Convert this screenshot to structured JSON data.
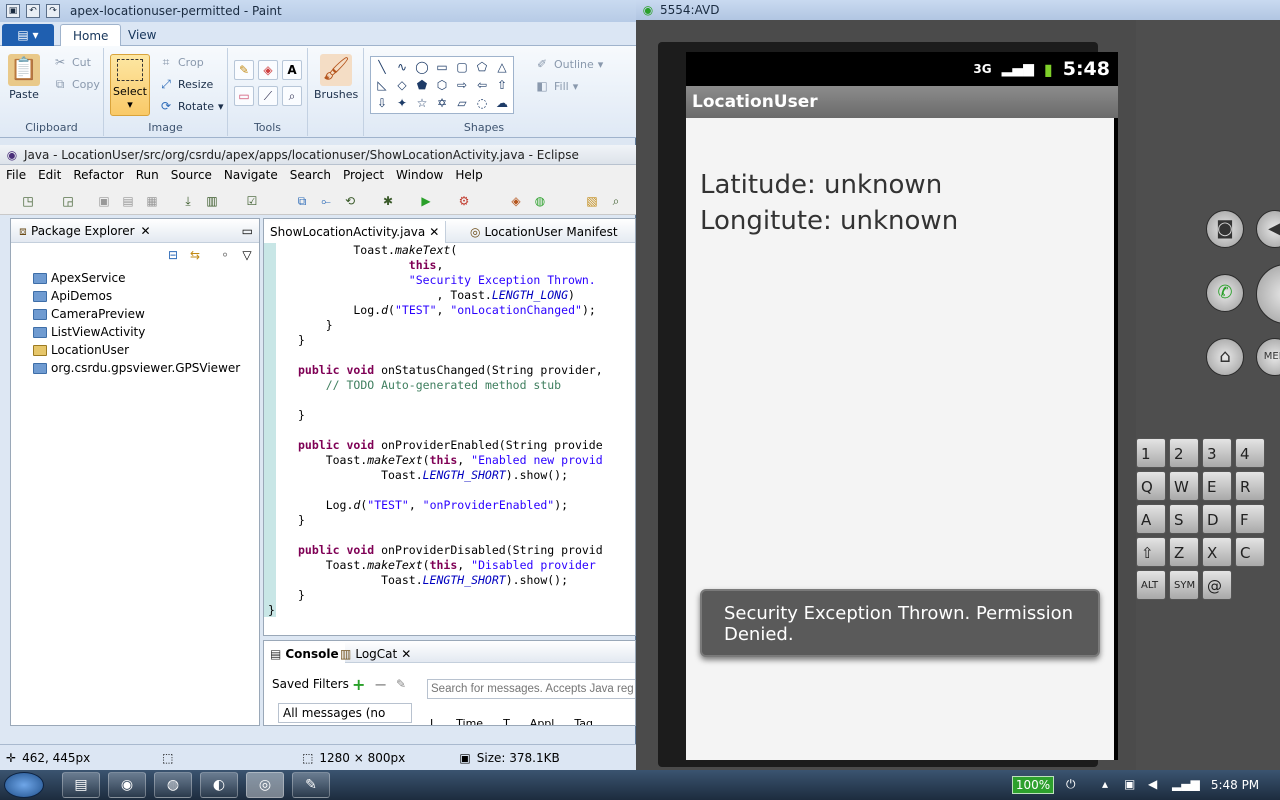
{
  "paint": {
    "title": "apex-locationuser-permitted - Paint",
    "tabs": {
      "home": "Home",
      "view": "View"
    },
    "clipboard": {
      "paste": "Paste",
      "cut": "Cut",
      "copy": "Copy",
      "label": "Clipboard"
    },
    "image": {
      "select": "Select",
      "crop": "Crop",
      "resize": "Resize",
      "rotate": "Rotate",
      "label": "Image"
    },
    "tools": {
      "label": "Tools"
    },
    "brushes": {
      "label": "Brushes"
    },
    "shapes": {
      "outline": "Outline",
      "fill": "Fill",
      "label": "Shapes"
    },
    "status": {
      "cursor": "462, 445px",
      "dimensions": "1280 × 800px",
      "size": "Size: 378.1KB"
    }
  },
  "eclipse": {
    "title": "Java - LocationUser/src/org/csrdu/apex/apps/locationuser/ShowLocationActivity.java - Eclipse",
    "menu": [
      "File",
      "Edit",
      "Refactor",
      "Run",
      "Source",
      "Navigate",
      "Search",
      "Project",
      "Window",
      "Help"
    ],
    "package_explorer": {
      "title": "Package Explorer",
      "projects": [
        "ApexService",
        "ApiDemos",
        "CameraPreview",
        "ListViewActivity",
        "LocationUser",
        "org.csrdu.gpsviewer.GPSViewer"
      ]
    },
    "editor_tabs": [
      "ShowLocationActivity.java",
      "LocationUser Manifest"
    ],
    "console": {
      "tab_console": "Console",
      "tab_logcat": "LogCat",
      "saved_filters": "Saved Filters",
      "all_messages": "All messages (no filters)",
      "search_placeholder": "Search for messages. Accepts Java reg",
      "columns": [
        "L",
        "Time",
        "T",
        "Appl",
        "Tag"
      ]
    }
  },
  "avd": {
    "title": "5554:AVD",
    "status_time": "5:48",
    "app_title": "LocationUser",
    "latitude": "Latitude:  unknown",
    "longitude": "Longitute:  unknown",
    "toast": "Security Exception Thrown. Permission Denied.",
    "keyboard_rows": [
      [
        "1",
        "2",
        "3",
        "4"
      ],
      [
        "Q",
        "W",
        "E",
        "R"
      ],
      [
        "A",
        "S",
        "D",
        "F"
      ],
      [
        "⇧",
        "Z",
        "X",
        "C"
      ],
      [
        "ALT",
        "SYM",
        "@"
      ]
    ]
  },
  "taskbar": {
    "battery": "100%",
    "clock": "5:48 PM"
  }
}
